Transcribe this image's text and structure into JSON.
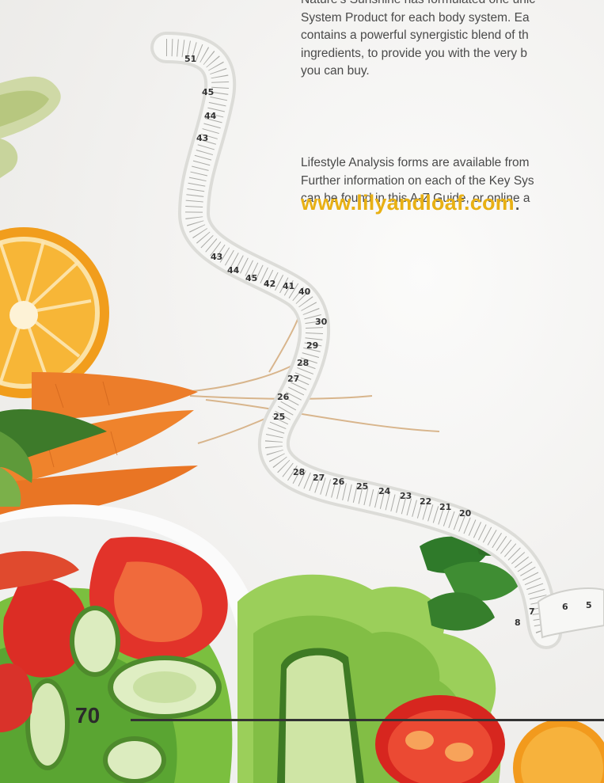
{
  "body_paragraph_1": [
    "Nature’s Sunshine has formulated one unic",
    "System Product for each body system. Ea",
    "contains a powerful synergistic blend of th",
    "ingredients, to provide you with the very b",
    "you can buy."
  ],
  "body_paragraph_2": [
    "Lifestyle Analysis forms are available from",
    "Further information on each of the Key Sys",
    "can be found in this A-Z Guide, or online a"
  ],
  "website": {
    "url": "www.lilyandloaf.com",
    "trailing": "."
  },
  "tape_numbers": [
    "51",
    "45",
    "44",
    "43",
    "43",
    "44",
    "45",
    "40",
    "41",
    "42",
    "30",
    "29",
    "28",
    "27",
    "26",
    "25",
    "28",
    "27",
    "26",
    "25",
    "24",
    "23",
    "22",
    "21",
    "20",
    "8",
    "7",
    "6",
    "5"
  ],
  "page_number": "70",
  "colors": {
    "accent": "#e8b014",
    "text": "#4a4a4a",
    "rule": "#333333"
  }
}
